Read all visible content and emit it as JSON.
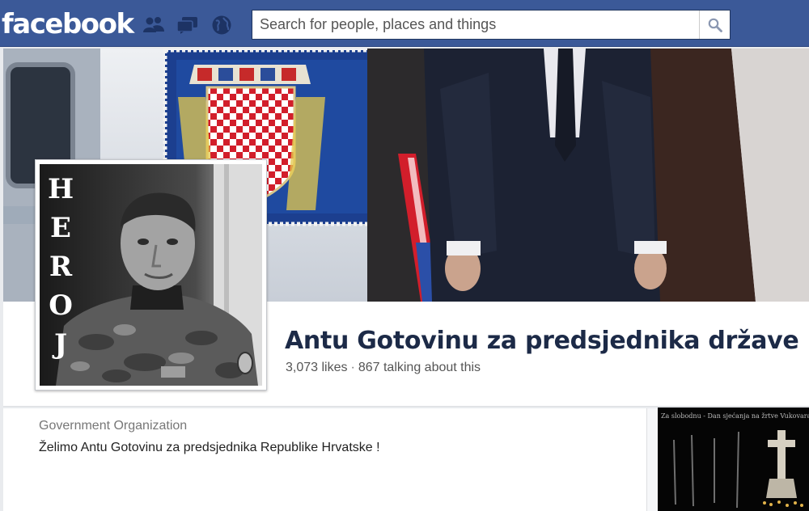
{
  "topbar": {
    "logo": "facebook",
    "search_placeholder": "Search for people, places and things",
    "icons": [
      "friend-requests-icon",
      "messages-icon",
      "notifications-globe-icon",
      "search-icon"
    ]
  },
  "cover": {
    "description_icons": [
      "croatian-coat-of-arms-flag",
      "person-in-suit"
    ]
  },
  "profile": {
    "picture_text": [
      "H",
      "E",
      "R",
      "O",
      "J"
    ],
    "name": "Antu Gotovinu za predsjednika države",
    "likes": "3,073 likes",
    "separator": "·",
    "talking": "867 talking about this"
  },
  "about": {
    "category": "Government Organization",
    "description": "Želimo Antu Gotovinu za predsjednika Republike Hrvatske !"
  },
  "sidebar": {
    "thumbnail_caption": "Za slobodnu - Dan sjećanja na žrtve Vukovara"
  },
  "colors": {
    "topbar": "#3b5998",
    "name": "#1c2a47",
    "muted": "#555555"
  }
}
